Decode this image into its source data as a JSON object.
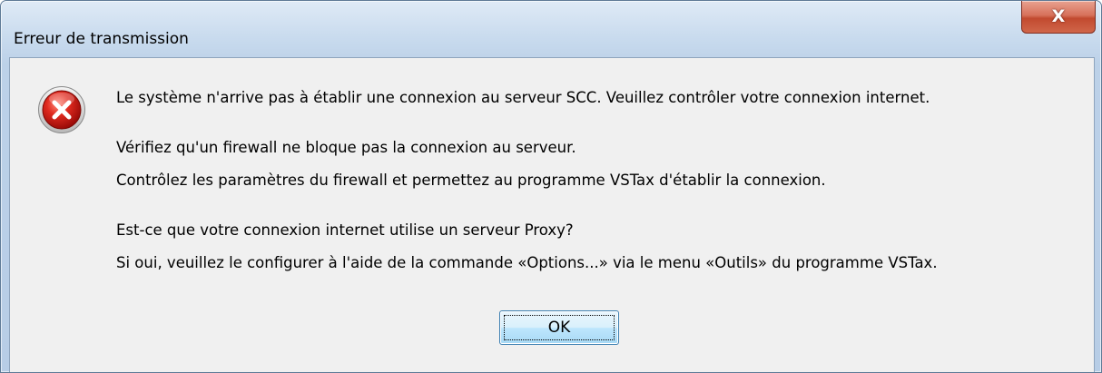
{
  "window": {
    "title": "Erreur de transmission",
    "close_glyph": "X"
  },
  "dialog": {
    "icon": "error-icon",
    "lines": [
      "Le système n'arrive pas à établir une connexion au serveur SCC. Veuillez contrôler votre connexion internet.",
      "Vérifiez qu'un firewall ne bloque pas la connexion au serveur.",
      "Contrôlez les paramètres du firewall et permettez au programme VSTax d'établir la connexion.",
      "Est-ce que votre connexion internet utilise un serveur Proxy?",
      "Si oui, veuillez le configurer à l'aide de la commande «Options...» via le menu «Outils» du programme VSTax."
    ],
    "ok_label": "OK"
  },
  "colors": {
    "error_red": "#d11f1f",
    "close_button": "#c24a2f",
    "frame_blue": "#bcd1e8",
    "client_bg": "#f0f0f0"
  }
}
